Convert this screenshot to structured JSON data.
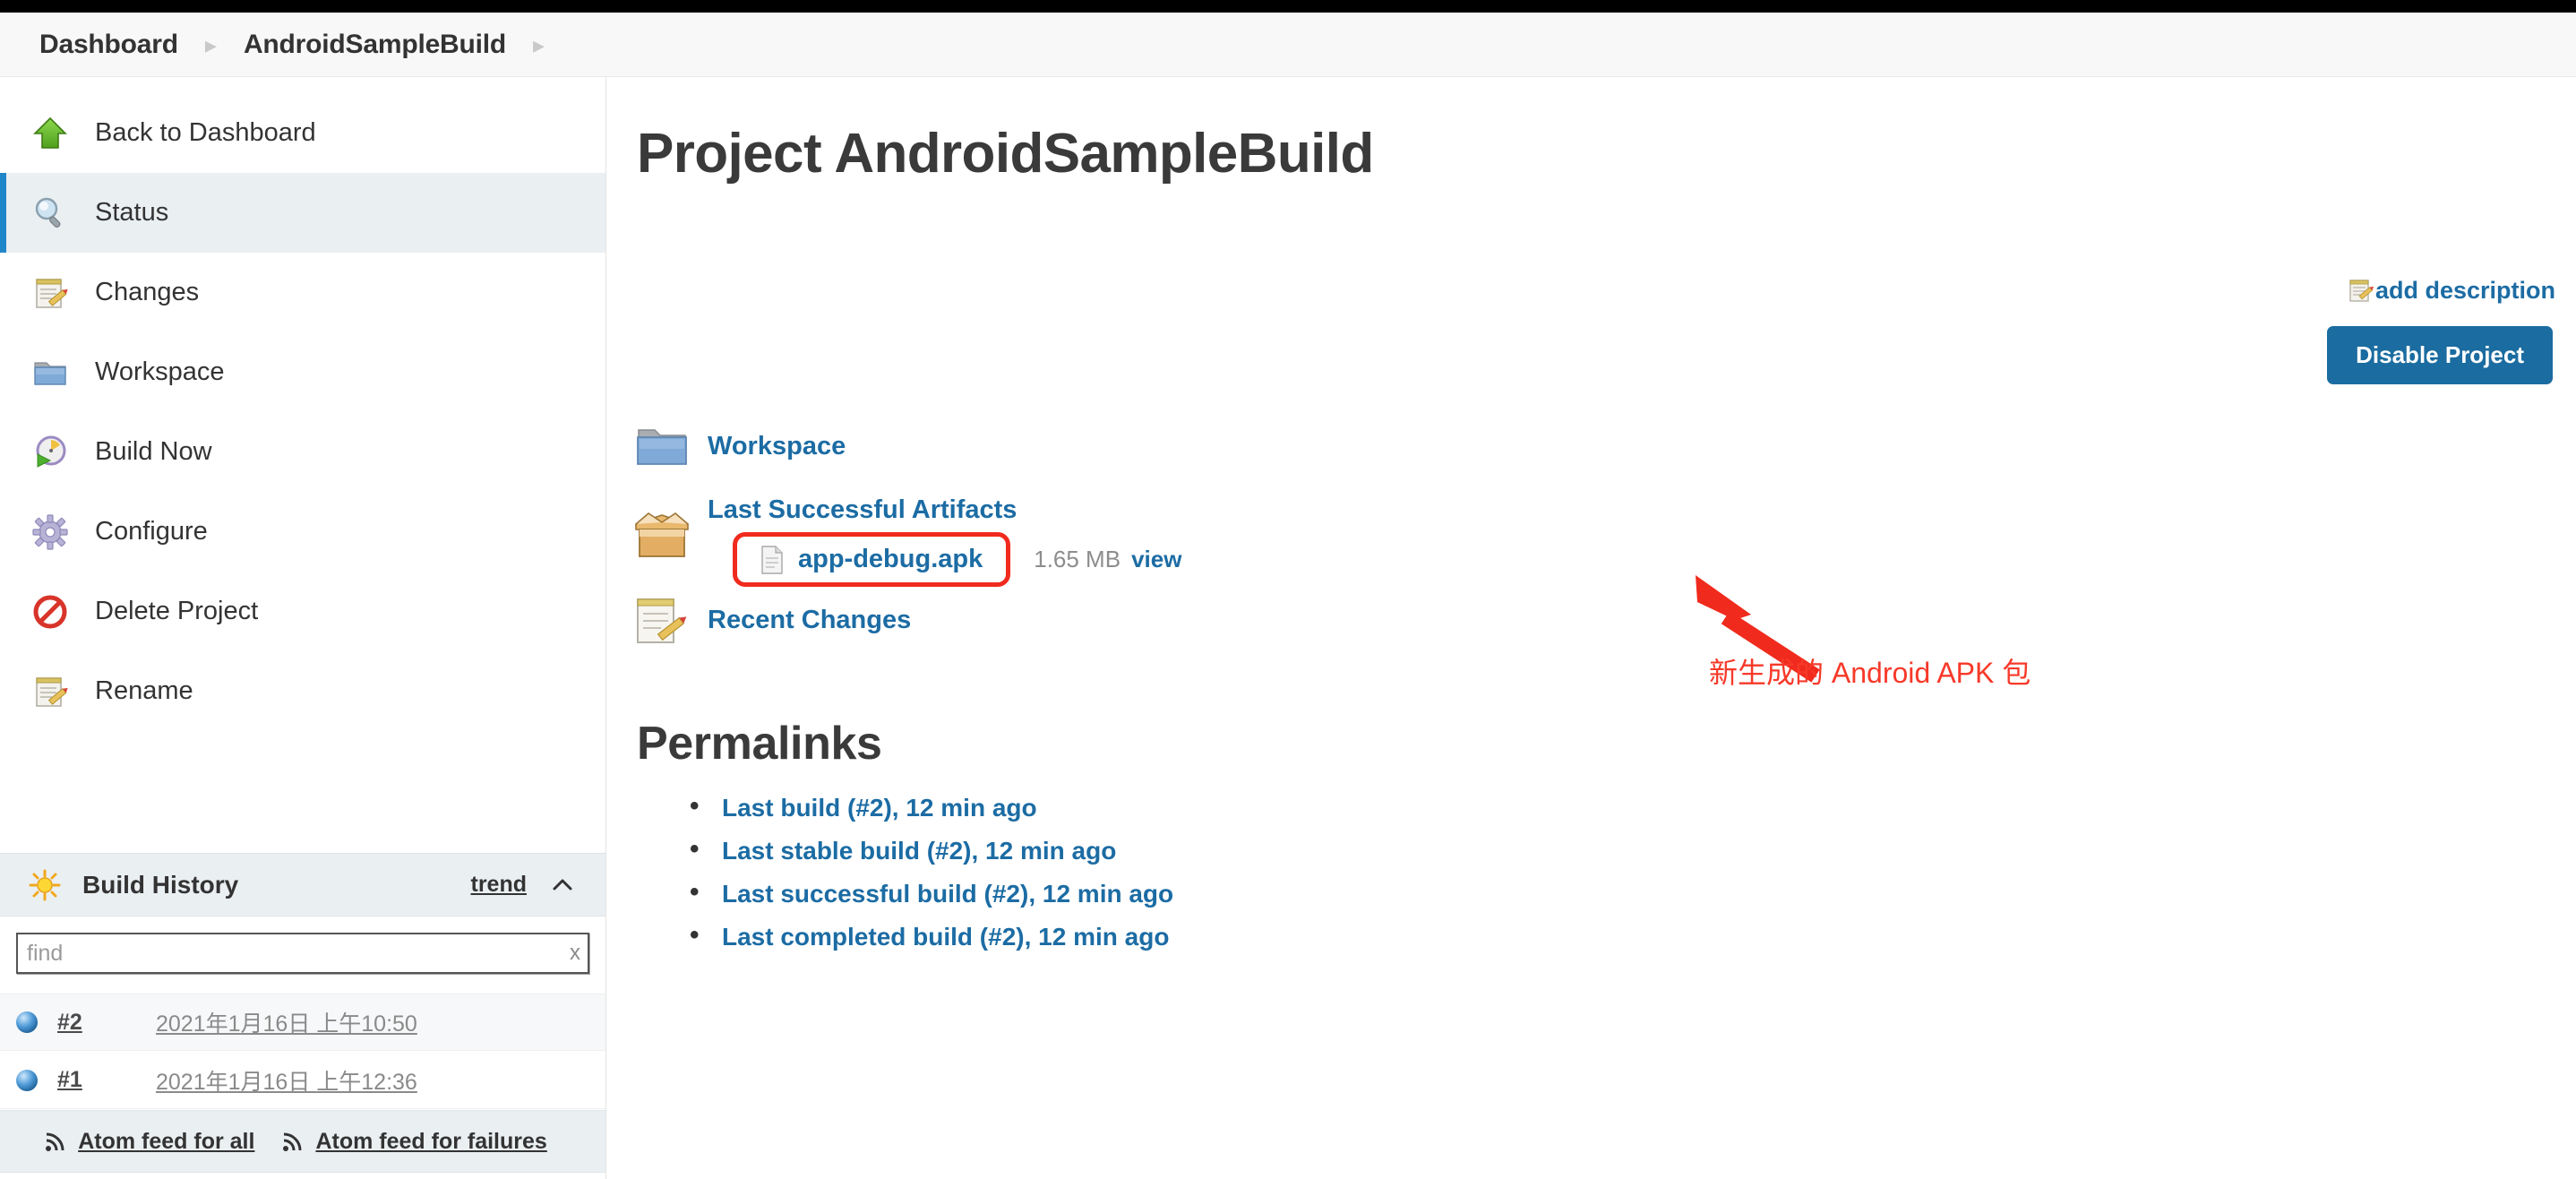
{
  "breadcrumb": {
    "items": [
      "Dashboard",
      "AndroidSampleBuild"
    ],
    "separator": "▸"
  },
  "sidebar": {
    "items": [
      {
        "label": "Back to Dashboard",
        "icon": "up-arrow-icon",
        "active": false
      },
      {
        "label": "Status",
        "icon": "magnifier-icon",
        "active": true
      },
      {
        "label": "Changes",
        "icon": "notepad-pencil-icon",
        "active": false
      },
      {
        "label": "Workspace",
        "icon": "folder-icon",
        "active": false
      },
      {
        "label": "Build Now",
        "icon": "clock-play-icon",
        "active": false
      },
      {
        "label": "Configure",
        "icon": "gear-icon",
        "active": false
      },
      {
        "label": "Delete Project",
        "icon": "no-entry-icon",
        "active": false
      },
      {
        "label": "Rename",
        "icon": "notepad-pencil-icon",
        "active": false
      }
    ],
    "build_history": {
      "title": "Build History",
      "icon": "sun-icon",
      "trend_label": "trend",
      "collapse_icon": "chevron-up-icon",
      "find": {
        "placeholder": "find",
        "value": "",
        "clear_label": "x"
      },
      "builds": [
        {
          "number": "#2",
          "timestamp": "2021年1月16日 上午10:50",
          "status_icon": "blue-ball-icon"
        },
        {
          "number": "#1",
          "timestamp": "2021年1月16日 上午12:36",
          "status_icon": "blue-ball-icon"
        }
      ],
      "feeds": [
        {
          "label": "Atom feed for all",
          "icon": "rss-icon"
        },
        {
          "label": "Atom feed for failures",
          "icon": "rss-icon"
        }
      ]
    }
  },
  "main": {
    "title": "Project AndroidSampleBuild",
    "add_description": {
      "label": "add description",
      "icon": "notepad-pencil-icon"
    },
    "disable_button": "Disable Project",
    "workspace": {
      "label": "Workspace",
      "icon": "folder-icon"
    },
    "artifacts": {
      "title": "Last Successful Artifacts",
      "icon": "package-box-icon",
      "file": {
        "name": "app-debug.apk",
        "icon": "document-icon",
        "size": "1.65 MB",
        "view_label": "view"
      }
    },
    "recent_changes": {
      "label": "Recent Changes",
      "icon": "notepad-pencil-icon"
    },
    "annotation": {
      "text": "新生成的 Android APK 包",
      "color": "#f73929"
    },
    "permalinks": {
      "title": "Permalinks",
      "items": [
        "Last build (#2), 12 min ago",
        "Last stable build (#2), 12 min ago",
        "Last successful build (#2), 12 min ago",
        "Last completed build (#2), 12 min ago"
      ]
    }
  },
  "colors": {
    "accent_link": "#1c6ca4",
    "button_blue": "#1b6ca0",
    "active_nav_bar": "#1f86c9",
    "annotation_red": "#f02b1d",
    "panel_bg": "#eaeff2"
  }
}
